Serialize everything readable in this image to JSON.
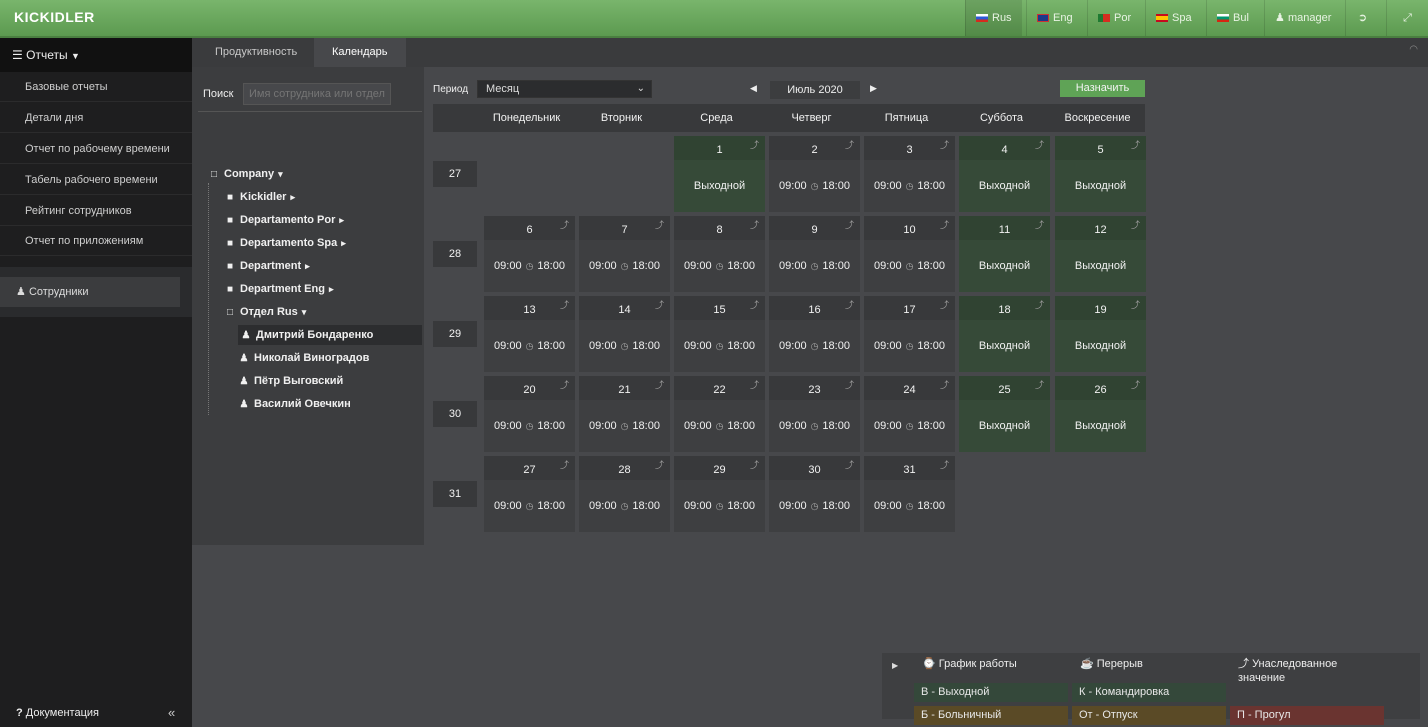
{
  "app": {
    "logo": "KICKIDLER"
  },
  "topbar": {
    "languages": [
      {
        "label": "Rus",
        "active": true
      },
      {
        "label": "Eng",
        "active": false
      },
      {
        "label": "Por",
        "active": false
      },
      {
        "label": "Spa",
        "active": false
      },
      {
        "label": "Bul",
        "active": false
      }
    ],
    "user": "manager"
  },
  "sidebar": {
    "header": "Отчеты",
    "items": [
      "Базовые отчеты",
      "Детали дня",
      "Отчет по рабочему времени",
      "Табель рабочего времени",
      "Рейтинг сотрудников",
      "Отчет по приложениям"
    ],
    "employees": "Сотрудники",
    "docs": "Документация",
    "collapse": "«"
  },
  "tabs": [
    {
      "label": "Продуктивность",
      "active": false
    },
    {
      "label": "Календарь",
      "active": true
    }
  ],
  "search": {
    "label": "Поиск",
    "placeholder": "Имя сотрудника или отдела"
  },
  "tree": [
    {
      "label": "Company",
      "type": "folder-open",
      "caret": "▾",
      "level": 0
    },
    {
      "label": "Kickidler",
      "type": "folder",
      "caret": "▸",
      "level": 1
    },
    {
      "label": "Departamento Por",
      "type": "folder",
      "caret": "▸",
      "level": 1
    },
    {
      "label": "Departamento Spa",
      "type": "folder",
      "caret": "▸",
      "level": 1
    },
    {
      "label": "Department",
      "type": "folder",
      "caret": "▸",
      "level": 1
    },
    {
      "label": "Department Eng",
      "type": "folder",
      "caret": "▸",
      "level": 1
    },
    {
      "label": "Отдел Rus",
      "type": "folder-open",
      "caret": "▾",
      "level": 1
    },
    {
      "label": "Дмитрий Бондаренко",
      "type": "user",
      "caret": "",
      "level": 2,
      "selected": true
    },
    {
      "label": "Николай Виноградов",
      "type": "user",
      "caret": "",
      "level": 2
    },
    {
      "label": "Пётр Выговский",
      "type": "user",
      "caret": "",
      "level": 2
    },
    {
      "label": "Василий Овечкин",
      "type": "user",
      "caret": "",
      "level": 2
    }
  ],
  "calendar": {
    "period_label": "Период",
    "period_value": "Месяц",
    "month": "Июль 2020",
    "assign": "Назначить",
    "weekdays": [
      "Понедельник",
      "Вторник",
      "Среда",
      "Четверг",
      "Пятница",
      "Суббота",
      "Воскресение"
    ],
    "weeks": [
      {
        "num": "27",
        "days": [
          null,
          null,
          {
            "d": "1",
            "off": true,
            "text": "Выходной"
          },
          {
            "d": "2",
            "from": "09:00",
            "to": "18:00"
          },
          {
            "d": "3",
            "from": "09:00",
            "to": "18:00"
          },
          {
            "d": "4",
            "off": true,
            "text": "Выходной"
          },
          {
            "d": "5",
            "off": true,
            "text": "Выходной"
          }
        ]
      },
      {
        "num": "28",
        "days": [
          {
            "d": "6",
            "from": "09:00",
            "to": "18:00"
          },
          {
            "d": "7",
            "from": "09:00",
            "to": "18:00"
          },
          {
            "d": "8",
            "from": "09:00",
            "to": "18:00"
          },
          {
            "d": "9",
            "from": "09:00",
            "to": "18:00"
          },
          {
            "d": "10",
            "from": "09:00",
            "to": "18:00"
          },
          {
            "d": "11",
            "off": true,
            "text": "Выходной"
          },
          {
            "d": "12",
            "off": true,
            "text": "Выходной"
          }
        ]
      },
      {
        "num": "29",
        "days": [
          {
            "d": "13",
            "from": "09:00",
            "to": "18:00"
          },
          {
            "d": "14",
            "from": "09:00",
            "to": "18:00"
          },
          {
            "d": "15",
            "from": "09:00",
            "to": "18:00"
          },
          {
            "d": "16",
            "from": "09:00",
            "to": "18:00"
          },
          {
            "d": "17",
            "from": "09:00",
            "to": "18:00"
          },
          {
            "d": "18",
            "off": true,
            "text": "Выходной"
          },
          {
            "d": "19",
            "off": true,
            "text": "Выходной"
          }
        ]
      },
      {
        "num": "30",
        "days": [
          {
            "d": "20",
            "from": "09:00",
            "to": "18:00"
          },
          {
            "d": "21",
            "from": "09:00",
            "to": "18:00"
          },
          {
            "d": "22",
            "from": "09:00",
            "to": "18:00"
          },
          {
            "d": "23",
            "from": "09:00",
            "to": "18:00"
          },
          {
            "d": "24",
            "from": "09:00",
            "to": "18:00"
          },
          {
            "d": "25",
            "off": true,
            "text": "Выходной"
          },
          {
            "d": "26",
            "off": true,
            "text": "Выходной"
          }
        ]
      },
      {
        "num": "31",
        "days": [
          {
            "d": "27",
            "from": "09:00",
            "to": "18:00"
          },
          {
            "d": "28",
            "from": "09:00",
            "to": "18:00"
          },
          {
            "d": "29",
            "from": "09:00",
            "to": "18:00"
          },
          {
            "d": "30",
            "from": "09:00",
            "to": "18:00"
          },
          {
            "d": "31",
            "from": "09:00",
            "to": "18:00"
          },
          null,
          null
        ]
      }
    ]
  },
  "legend": {
    "headers": [
      "График работы",
      "Перерыв",
      "Унаследованное значение"
    ],
    "items": [
      {
        "label": "В - Выходной",
        "color": "#34483a"
      },
      {
        "label": "К - Командировка",
        "color": "#34483a"
      },
      {
        "label": "Б - Больничный",
        "color": "#5a4a26"
      },
      {
        "label": "От - Отпуск",
        "color": "#5a4a26"
      },
      {
        "label": "П - Прогул",
        "color": "#6a3430"
      }
    ]
  },
  "colors": {
    "accent": "#5fa356",
    "weekend": "#364a38",
    "topbar": "#6aa85e"
  }
}
